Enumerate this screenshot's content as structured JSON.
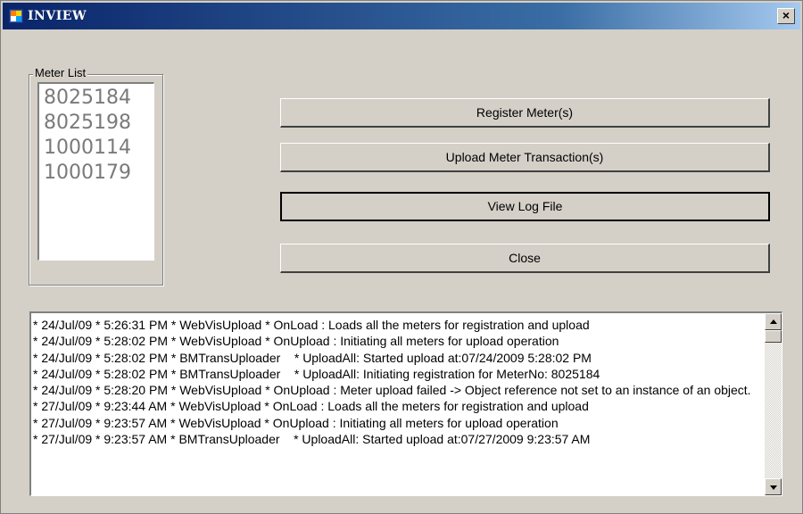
{
  "window": {
    "title": "INVIEW",
    "close_symbol": "×"
  },
  "meter_group": {
    "label": "Meter List",
    "meters": [
      "8025184",
      "8025198",
      "1000114",
      "1000179"
    ]
  },
  "buttons": {
    "register": "Register Meter(s)",
    "upload": "Upload Meter Transaction(s)",
    "view_log": "View Log File",
    "close": "Close"
  },
  "log": {
    "text": "* 24/Jul/09 * 5:26:31 PM * WebVisUpload * OnLoad : Loads all the meters for registration and upload\n* 24/Jul/09 * 5:28:02 PM * WebVisUpload * OnUpload : Initiating all meters for upload operation\n* 24/Jul/09 * 5:28:02 PM * BMTransUploader    * UploadAll: Started upload at:07/24/2009 5:28:02 PM\n* 24/Jul/09 * 5:28:02 PM * BMTransUploader    * UploadAll: Initiating registration for MeterNo: 8025184\n* 24/Jul/09 * 5:28:20 PM * WebVisUpload * OnUpload : Meter upload failed -> Object reference not set to an instance of an object.\n* 27/Jul/09 * 9:23:44 AM * WebVisUpload * OnLoad : Loads all the meters for registration and upload\n* 27/Jul/09 * 9:23:57 AM * WebVisUpload * OnUpload : Initiating all meters for upload operation\n* 27/Jul/09 * 9:23:57 AM * BMTransUploader    * UploadAll: Started upload at:07/27/2009 9:23:57 AM"
  }
}
